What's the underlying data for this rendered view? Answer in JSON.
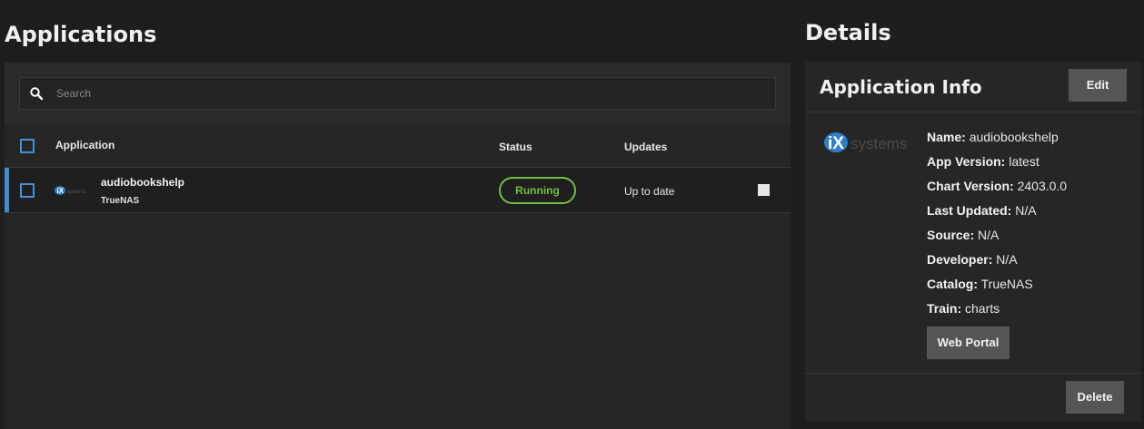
{
  "applications": {
    "title": "Applications",
    "search": {
      "placeholder": "Search"
    },
    "columns": {
      "application": "Application",
      "status": "Status",
      "updates": "Updates"
    },
    "rows": [
      {
        "name": "audiobookshelp",
        "catalog": "TrueNAS",
        "status": "Running",
        "updates": "Up to date",
        "icon": "ix-systems-logo"
      }
    ]
  },
  "details": {
    "title": "Details",
    "card_title": "Application Info",
    "edit_label": "Edit",
    "logo": "ix-systems-logo",
    "fields": [
      {
        "key": "Name:",
        "value": "audiobookshelp"
      },
      {
        "key": "App Version:",
        "value": "latest"
      },
      {
        "key": "Chart Version:",
        "value": "2403.0.0"
      },
      {
        "key": "Last Updated:",
        "value": "N/A"
      },
      {
        "key": "Source:",
        "value": "N/A"
      },
      {
        "key": "Developer:",
        "value": "N/A"
      },
      {
        "key": "Catalog:",
        "value": "TrueNAS"
      },
      {
        "key": "Train:",
        "value": "charts"
      }
    ],
    "web_portal_label": "Web Portal",
    "delete_label": "Delete"
  },
  "colors": {
    "accent": "#3d8fd1",
    "running": "#71bf44",
    "background": "#1e1e1e",
    "panel": "#262626"
  }
}
